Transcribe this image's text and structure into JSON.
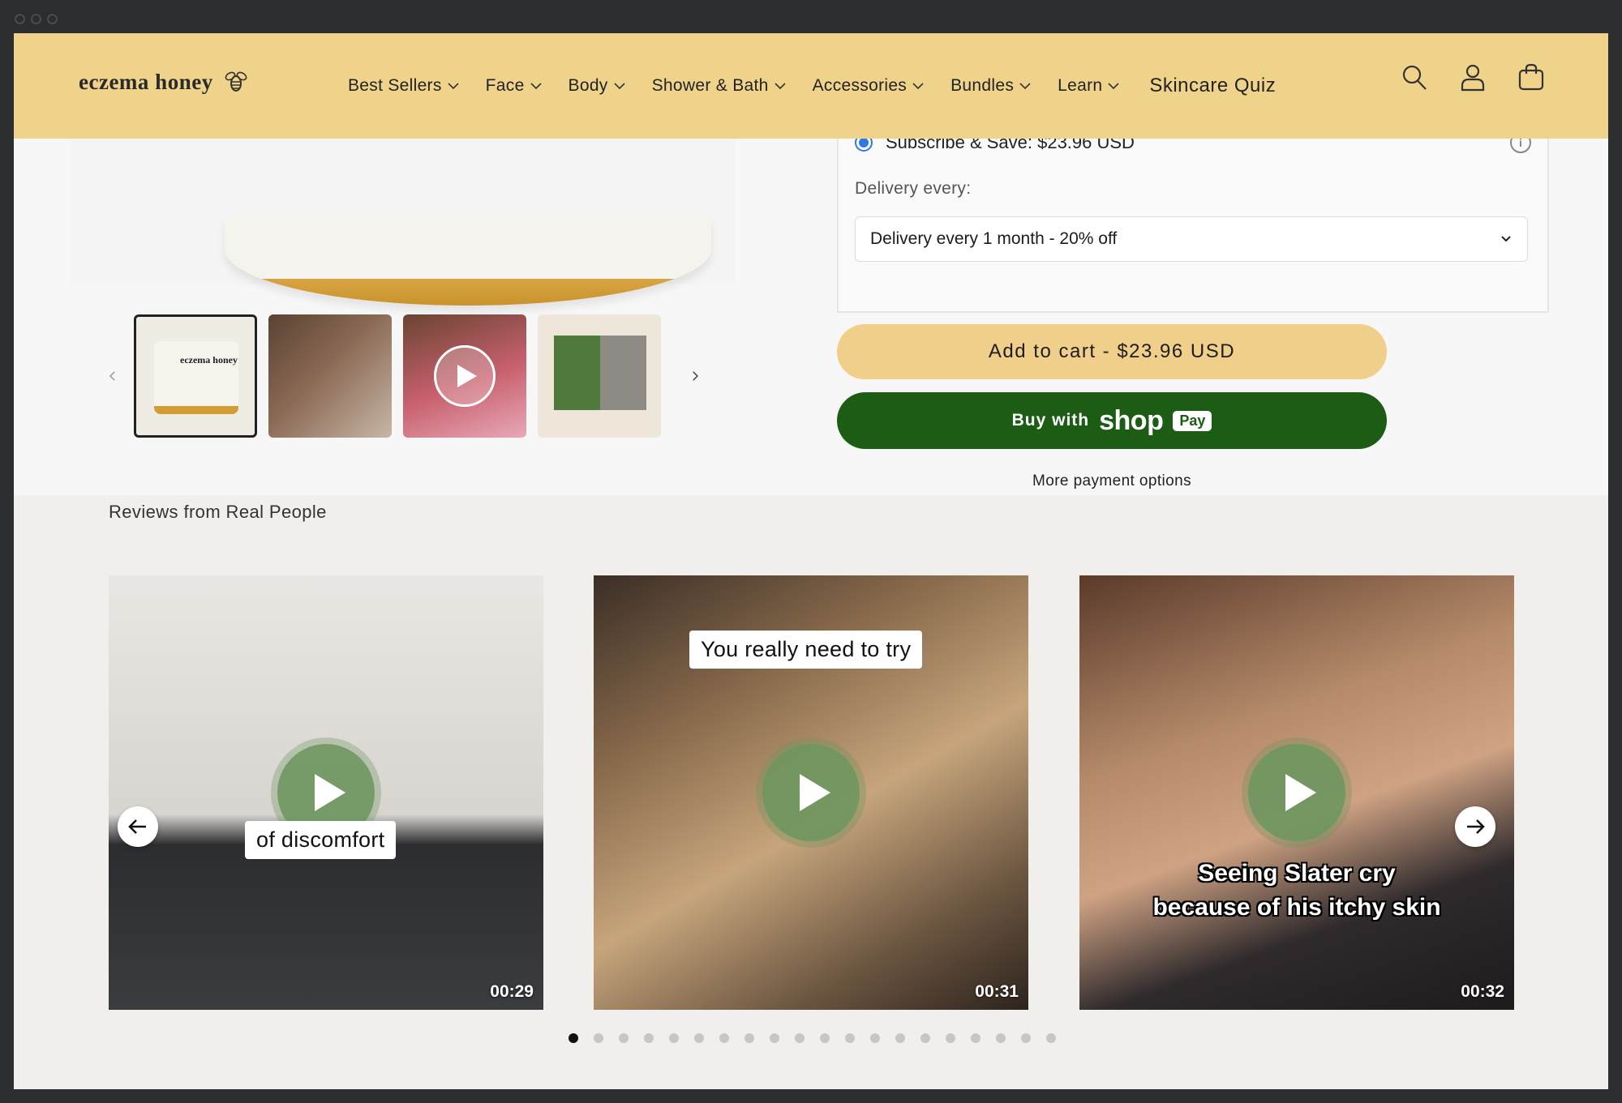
{
  "brand": {
    "logo_text": "eczema honey"
  },
  "nav": {
    "items": [
      {
        "label": "Best Sellers"
      },
      {
        "label": "Face"
      },
      {
        "label": "Body"
      },
      {
        "label": "Shower & Bath"
      },
      {
        "label": "Accessories"
      },
      {
        "label": "Bundles"
      },
      {
        "label": "Learn"
      }
    ],
    "quiz_label": "Skincare Quiz",
    "icons": [
      "search-icon",
      "account-icon",
      "cart-icon"
    ]
  },
  "purchase": {
    "subscribe_label": "Subscribe & Save: $23.96 USD",
    "delivery_label": "Delivery every:",
    "delivery_value": "Delivery every 1 month - 20% off",
    "add_to_cart": "Add to cart - $23.96 USD",
    "shop_pay_buy": "Buy with",
    "shop_pay_logo": "shop",
    "shop_pay_badge": "Pay",
    "more_payment": "More payment options"
  },
  "thumbnails": [
    {
      "label": "eczema honey"
    },
    {
      "label": ""
    },
    {
      "label": ""
    },
    {
      "label": ""
    }
  ],
  "reviews": {
    "title": "Reviews from Real People",
    "videos": [
      {
        "caption": "of discomfort",
        "duration": "00:29"
      },
      {
        "caption": "You really need to try",
        "duration": "00:31"
      },
      {
        "caption_line1": "Seeing Slater cry",
        "caption_line2": "because of his itchy skin",
        "duration": "00:32"
      }
    ],
    "dot_count": 20,
    "active_dot": 0
  },
  "colors": {
    "header_bg": "#f0d38a",
    "add_to_cart_bg": "#f0cf8a",
    "shop_pay_bg": "#1d5c15",
    "play_button": "#6e965f"
  }
}
